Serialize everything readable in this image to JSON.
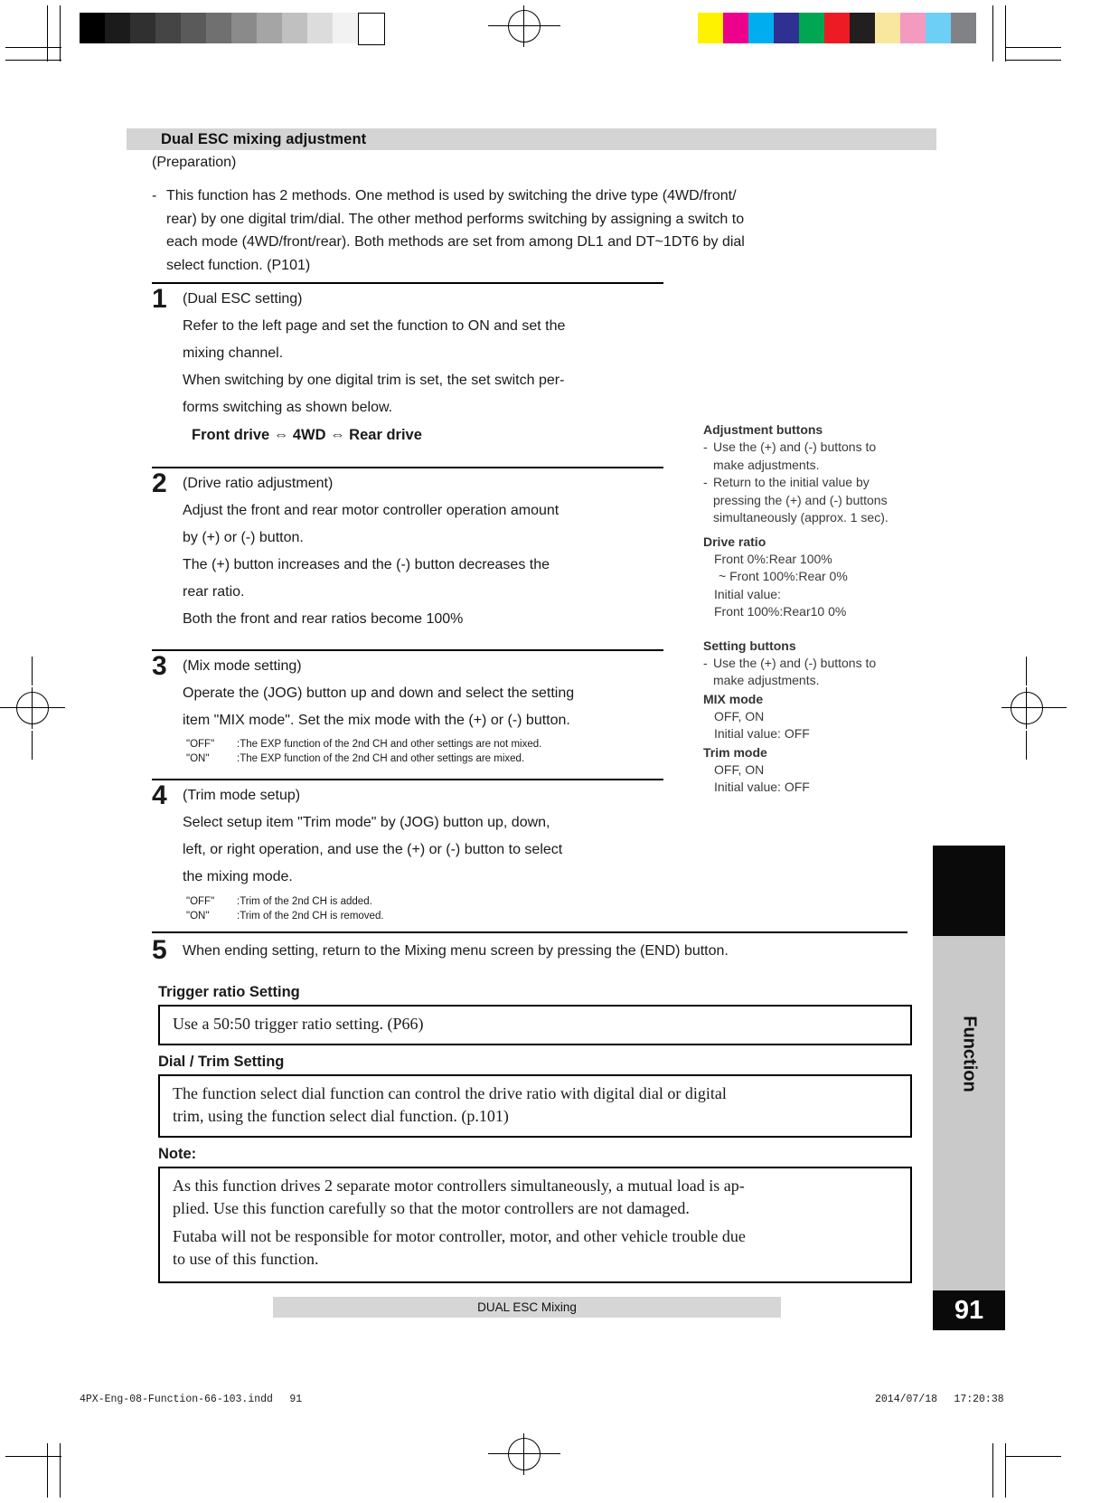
{
  "section": {
    "title": "Dual ESC mixing adjustment"
  },
  "preparation": {
    "label": "(Preparation)",
    "dash": "-",
    "text_line1": "This function has 2 methods. One method is used by switching the drive type (4WD/front/",
    "text_line2": "rear) by one digital trim/dial. The other method performs switching by assigning a switch to",
    "text_line3": "each mode (4WD/front/rear). Both methods are set from among DL1 and DT~1DT6 by dial",
    "text_line4": "select function. (P101)"
  },
  "steps": {
    "s1": {
      "num": "1",
      "title": "(Dual ESC setting)",
      "p1_l1": "Refer to the left page and set the function to ON and set the",
      "p1_l2": "mixing channel.",
      "p2_l1": "When switching by one digital trim is set, the set switch per-",
      "p2_l2": "forms switching as shown below.",
      "midhead": "Front drive ⇔ 4WD ⇔ Rear drive"
    },
    "s2": {
      "num": "2",
      "title": "(Drive ratio adjustment)",
      "p1_l1": "Adjust the front and rear motor controller operation amount",
      "p1_l2": "by (+) or (-) button.",
      "p2_l1": "The (+) button increases and the (-) button decreases the",
      "p2_l2": "rear ratio.",
      "p3": "Both the front and rear ratios become 100%"
    },
    "s3": {
      "num": "3",
      "title": "(Mix mode setting)",
      "p1_l1": "Operate the (JOG) button up and down and select the setting",
      "p1_l2": "item \"MIX mode\". Set the mix mode with the (+) or (-) button.",
      "legend": [
        {
          "key": "\"OFF\"",
          "value": ":The EXP function of the 2nd CH and other settings are not mixed."
        },
        {
          "key": "\"ON\"",
          "value": ":The EXP function of the 2nd CH and other settings are mixed."
        }
      ]
    },
    "s4": {
      "num": "4",
      "title": "(Trim mode setup)",
      "p1_l1": "Select setup item \"Trim mode\" by (JOG) button up, down,",
      "p1_l2": "left, or right operation, and use the (+) or (-) button to select",
      "p1_l3": "the mixing mode.",
      "legend": [
        {
          "key": "\"OFF\"",
          "value": ":Trim of the 2nd CH is added."
        },
        {
          "key": "\"ON\"",
          "value": ":Trim of the 2nd CH is removed."
        }
      ]
    },
    "s5": {
      "num": "5",
      "text": "When ending setting, return to the Mixing menu screen by pressing the (END) button."
    }
  },
  "side_notes": {
    "adjustment": {
      "heading": "Adjustment buttons",
      "dash": "-",
      "b1_l1": "Use the (+) and (-) buttons to",
      "b1_l2": "make adjustments.",
      "b2_l1": "Return to the initial value by",
      "b2_l2": "pressing the (+) and (-) buttons",
      "b2_l3": "simultaneously (approx. 1 sec)."
    },
    "drive_ratio": {
      "heading": "Drive ratio",
      "l1": "Front 0%:Rear 100%",
      "l2": "~ Front 100%:Rear 0%",
      "l3": "Initial value:",
      "l4": "Front 100%:Rear10 0%"
    },
    "setting": {
      "heading": "Setting buttons",
      "dash": "-",
      "b1_l1": "Use the (+) and (-) buttons to",
      "b1_l2": "make adjustments."
    },
    "mix_mode": {
      "heading": "MIX mode",
      "l1": "OFF, ON",
      "l2": "Initial value: OFF"
    },
    "trim_mode": {
      "heading": "Trim mode",
      "l1": "OFF, ON",
      "l2": "Initial value: OFF"
    }
  },
  "lower": {
    "trigger": {
      "heading": "Trigger ratio Setting",
      "text": "Use a 50:50 trigger ratio setting. (P66)"
    },
    "dial": {
      "heading": "Dial / Trim Setting",
      "l1": "The function select dial function can control the drive ratio with digital dial or digital",
      "l2": "trim, using the function select dial function. (p.101)"
    },
    "note": {
      "heading": "Note:",
      "p1_l1": "As this function drives 2 separate motor controllers simultaneously, a mutual load is ap-",
      "p1_l2": "plied. Use this function carefully so that the motor controllers are not damaged.",
      "p2_l1": "Futaba will not be responsible for motor controller, motor, and other vehicle trouble due",
      "p2_l2": "to use of this function."
    }
  },
  "tab": {
    "label": "Function"
  },
  "footer": {
    "caption": "DUAL ESC Mixing",
    "page_number": "91",
    "filename": "4PX-Eng-08-Function-66-103.indd  91",
    "timestamp": "2014/07/18  17:20:38"
  },
  "registration": {
    "greyscale": [
      "#000000",
      "#1b1b1b",
      "#303030",
      "#454545",
      "#5a5a5a",
      "#707070",
      "#8a8a8a",
      "#a5a5a5",
      "#c0c0c0",
      "#dcdcdc",
      "#f2f2f2",
      "#ffffff"
    ],
    "colors": [
      "#fff200",
      "#ec008c",
      "#00aeef",
      "#2e3192",
      "#00a651",
      "#ed1c24",
      "#231f20",
      "#f9e79f",
      "#f49ac1",
      "#6dcff6",
      "#808285"
    ]
  }
}
